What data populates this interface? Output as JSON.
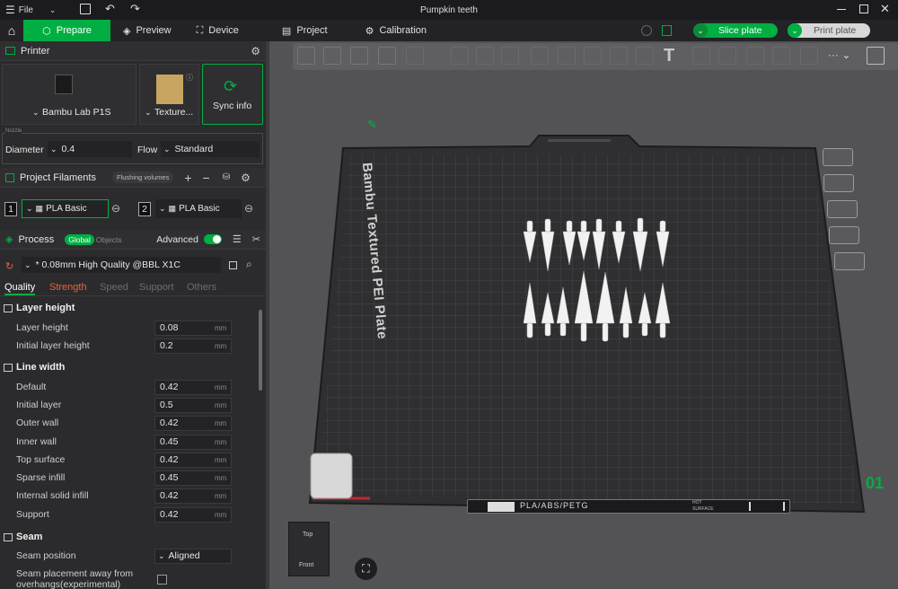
{
  "titlebar": {
    "menu_label": "File",
    "title": "Pumpkin teeth"
  },
  "tabs": {
    "prepare": "Prepare",
    "preview": "Preview",
    "device": "Device",
    "project": "Project",
    "calibration": "Calibration",
    "slice_plate": "Slice plate",
    "print_plate": "Print plate"
  },
  "printer": {
    "header": "Printer",
    "printer_name": "Bambu Lab P1S",
    "plate_name": "Texture...",
    "sync_label": "Sync info",
    "nozzle_legend": "Nozzle",
    "diameter_label": "Diameter",
    "diameter_value": "0.4",
    "flow_label": "Flow",
    "flow_value": "Standard"
  },
  "filaments": {
    "header": "Project Filaments",
    "flushing_label": "Flushing volumes",
    "items": [
      {
        "index": "1",
        "name": "PLA Basic"
      },
      {
        "index": "2",
        "name": "PLA Basic"
      }
    ]
  },
  "process": {
    "header": "Process",
    "global_label": "Global",
    "objects_label": "Objects",
    "advanced_label": "Advanced",
    "preset": "* 0.08mm High Quality @BBL X1C",
    "subtabs": [
      "Quality",
      "Strength",
      "Speed",
      "Support",
      "Others"
    ]
  },
  "quality": {
    "layer_height_title": "Layer height",
    "line_width_title": "Line width",
    "seam_title": "Seam",
    "unit": "mm",
    "layer_rows": [
      {
        "label": "Layer height",
        "value": "0.08"
      },
      {
        "label": "Initial layer height",
        "value": "0.2"
      }
    ],
    "line_rows": [
      {
        "label": "Default",
        "value": "0.42"
      },
      {
        "label": "Initial layer",
        "value": "0.5"
      },
      {
        "label": "Outer wall",
        "value": "0.42"
      },
      {
        "label": "Inner wall",
        "value": "0.45"
      },
      {
        "label": "Top surface",
        "value": "0.42"
      },
      {
        "label": "Sparse infill",
        "value": "0.45"
      },
      {
        "label": "Internal solid infill",
        "value": "0.42"
      },
      {
        "label": "Support",
        "value": "0.42"
      }
    ],
    "seam_position_label": "Seam position",
    "seam_position_value": "Aligned",
    "seam_away_label_1": "Seam placement away from",
    "seam_away_label_2": "overhangs(experimental)"
  },
  "viewport": {
    "plate_label": "Bambu Textured PEI Plate",
    "plate_strip_text": "PLA/ABS/PETG",
    "hot_surface_1": "HOT",
    "hot_surface_2": "SURFACE",
    "plate_number": "01",
    "view_top": "Top",
    "view_front": "Front"
  },
  "colors": {
    "accent": "#00ae42",
    "strength_tab": "#e8623a"
  }
}
